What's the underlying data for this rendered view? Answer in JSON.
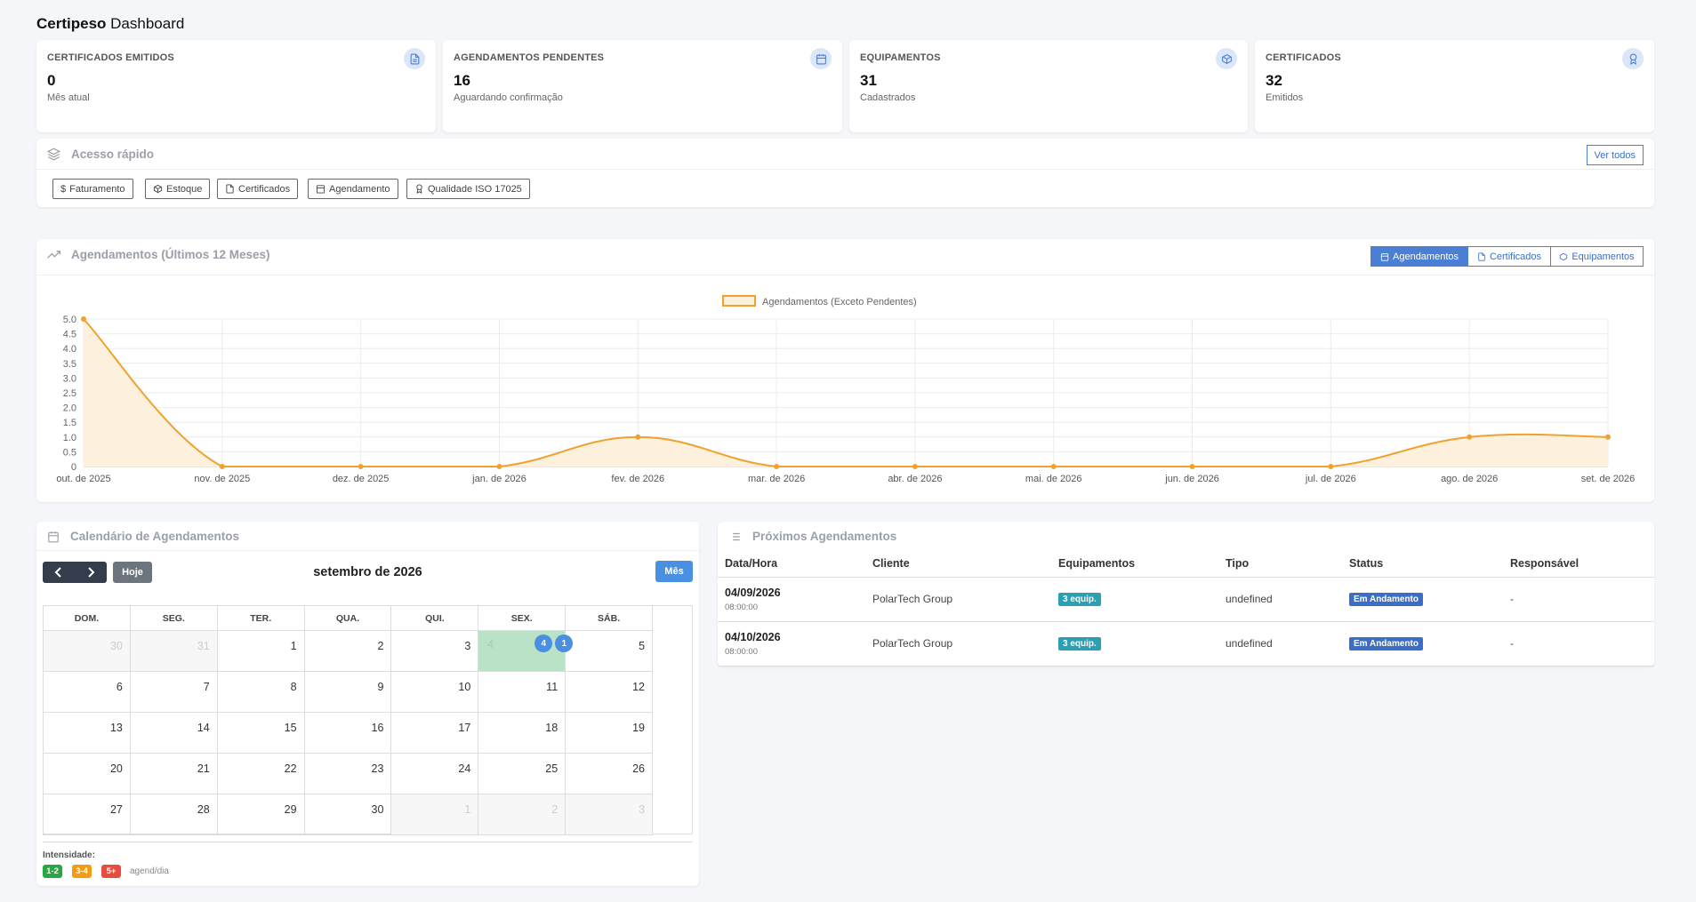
{
  "header": {
    "brand": "Certipeso",
    "title": "Dashboard"
  },
  "stats": [
    {
      "title": "CERTIFICADOS EMITIDOS",
      "value": "0",
      "sub": "Mês atual",
      "icon": "document-icon"
    },
    {
      "title": "AGENDAMENTOS PENDENTES",
      "value": "16",
      "sub": "Aguardando confirmação",
      "icon": "calendar-icon"
    },
    {
      "title": "EQUIPAMENTOS",
      "value": "31",
      "sub": "Cadastrados",
      "icon": "box-icon"
    },
    {
      "title": "CERTIFICADOS",
      "value": "32",
      "sub": "Emitidos",
      "icon": "award-icon"
    }
  ],
  "quick_access": {
    "title": "Acesso rápido",
    "see_all": "Ver todos",
    "items": [
      "Faturamento",
      "Estoque",
      "Certificados",
      "Agendamento",
      "Qualidade ISO 17025"
    ]
  },
  "chart_section": {
    "title": "Agendamentos (Últimos 12 Meses)",
    "tabs": [
      "Agendamentos",
      "Certificados",
      "Equipamentos"
    ],
    "active_tab": "Agendamentos"
  },
  "chart_data": {
    "type": "area",
    "categories": [
      "out. de 2025",
      "nov. de 2025",
      "dez. de 2025",
      "jan. de 2026",
      "fev. de 2026",
      "mar. de 2026",
      "abr. de 2026",
      "mai. de 2026",
      "jun. de 2026",
      "jul. de 2026",
      "ago. de 2026",
      "set. de 2026"
    ],
    "series": [
      {
        "name": "Agendamentos (Exceto Pendentes)",
        "values": [
          5,
          0,
          0,
          0,
          1,
          0,
          0,
          0,
          0,
          0,
          1,
          1
        ]
      }
    ],
    "ylim": [
      0,
      5
    ],
    "yticks": [
      "0",
      "0.5",
      "1.0",
      "1.5",
      "2.0",
      "2.5",
      "3.0",
      "3.5",
      "4.0",
      "4.5",
      "5.0"
    ],
    "grid": true,
    "legend": "top-center",
    "line_color": "#f0a22e",
    "fill_color": "#fdf0dc"
  },
  "calendar": {
    "title": "Calendário de Agendamentos",
    "today_label": "Hoje",
    "view_label": "Mês",
    "month_label": "setembro de 2026",
    "weekdays": [
      "DOM.",
      "SEG.",
      "TER.",
      "QUA.",
      "QUI.",
      "SEX.",
      "SÁB."
    ],
    "weeks": [
      [
        "30",
        "31",
        "1",
        "2",
        "3",
        "4",
        "5"
      ],
      [
        "6",
        "7",
        "8",
        "9",
        "10",
        "11",
        "12"
      ],
      [
        "13",
        "14",
        "15",
        "16",
        "17",
        "18",
        "19"
      ],
      [
        "20",
        "21",
        "22",
        "23",
        "24",
        "25",
        "26"
      ],
      [
        "27",
        "28",
        "29",
        "30",
        "1",
        "2",
        "3"
      ]
    ],
    "bubbles": [
      "4",
      "1"
    ],
    "intensity_label": "Intensidade:",
    "intensity": [
      {
        "label": "1-2",
        "color": "#28a745"
      },
      {
        "label": "3-4",
        "color": "#f39c12"
      },
      {
        "label": "5+",
        "color": "#e74c3c"
      }
    ],
    "intensity_unit": "agend/dia"
  },
  "upcoming": {
    "title": "Próximos Agendamentos",
    "columns": [
      "Data/Hora",
      "Cliente",
      "Equipamentos",
      "Tipo",
      "Status",
      "Responsável"
    ],
    "rows": [
      {
        "date": "04/09/2026",
        "time": "08:00:00",
        "client": "PolarTech Group",
        "equip": "3 equip.",
        "type": "undefined",
        "status": "Em Andamento",
        "resp": "-"
      },
      {
        "date": "04/10/2026",
        "time": "08:00:00",
        "client": "PolarTech Group",
        "equip": "3 equip.",
        "type": "undefined",
        "status": "Em Andamento",
        "resp": "-"
      }
    ]
  }
}
